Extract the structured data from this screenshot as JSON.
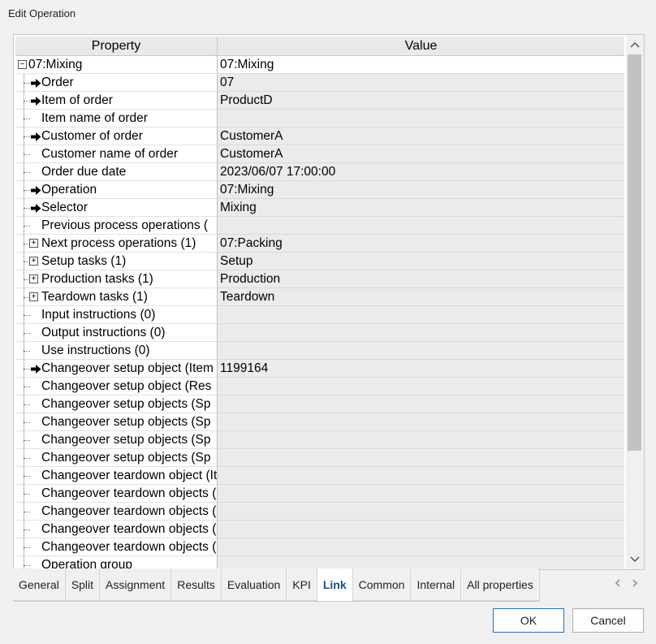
{
  "window": {
    "title": "Edit Operation"
  },
  "grid": {
    "header": {
      "property": "Property",
      "value": "Value"
    },
    "rows": [
      {
        "label": "07:Mixing",
        "value": "07:Mixing",
        "marker": "collapse",
        "root": true
      },
      {
        "label": "Order",
        "value": "07",
        "marker": "arrow"
      },
      {
        "label": "Item of order",
        "value": "ProductD",
        "marker": "arrow"
      },
      {
        "label": "Item name of order",
        "value": "",
        "marker": "none"
      },
      {
        "label": "Customer of order",
        "value": "CustomerA",
        "marker": "arrow"
      },
      {
        "label": "Customer name of order",
        "value": "CustomerA",
        "marker": "none"
      },
      {
        "label": "Order due date",
        "value": "2023/06/07 17:00:00",
        "marker": "none"
      },
      {
        "label": "Operation",
        "value": "07:Mixing",
        "marker": "arrow"
      },
      {
        "label": "Selector",
        "value": "Mixing",
        "marker": "arrow"
      },
      {
        "label": "Previous process operations (",
        "value": "",
        "marker": "none"
      },
      {
        "label": "Next process operations (1)",
        "value": "07:Packing",
        "marker": "expand"
      },
      {
        "label": "Setup tasks (1)",
        "value": "Setup",
        "marker": "expand"
      },
      {
        "label": "Production tasks (1)",
        "value": "Production",
        "marker": "expand"
      },
      {
        "label": "Teardown tasks (1)",
        "value": "Teardown",
        "marker": "expand"
      },
      {
        "label": "Input instructions (0)",
        "value": "",
        "marker": "none"
      },
      {
        "label": "Output instructions (0)",
        "value": "",
        "marker": "none"
      },
      {
        "label": "Use instructions (0)",
        "value": "",
        "marker": "none"
      },
      {
        "label": "Changeover setup object (Item",
        "value": "1199164",
        "marker": "arrow"
      },
      {
        "label": "Changeover setup object (Res",
        "value": "",
        "marker": "none"
      },
      {
        "label": "Changeover setup objects (Sp",
        "value": "",
        "marker": "none"
      },
      {
        "label": "Changeover setup objects (Sp",
        "value": "",
        "marker": "none"
      },
      {
        "label": "Changeover setup objects (Sp",
        "value": "",
        "marker": "none"
      },
      {
        "label": "Changeover setup objects (Sp",
        "value": "",
        "marker": "none"
      },
      {
        "label": "Changeover teardown object (It",
        "value": "",
        "marker": "none"
      },
      {
        "label": "Changeover teardown objects (",
        "value": "",
        "marker": "none"
      },
      {
        "label": "Changeover teardown objects (",
        "value": "",
        "marker": "none"
      },
      {
        "label": "Changeover teardown objects (",
        "value": "",
        "marker": "none"
      },
      {
        "label": "Changeover teardown objects (",
        "value": "",
        "marker": "none"
      },
      {
        "label": "Operation group",
        "value": "",
        "marker": "none"
      }
    ]
  },
  "scrollbar": {
    "up_icon": "chevron-up-icon",
    "down_icon": "chevron-down-icon"
  },
  "tabs": [
    {
      "label": "General",
      "active": false
    },
    {
      "label": "Split",
      "active": false
    },
    {
      "label": "Assignment",
      "active": false
    },
    {
      "label": "Results",
      "active": false
    },
    {
      "label": "Evaluation",
      "active": false
    },
    {
      "label": "KPI",
      "active": false
    },
    {
      "label": "Link",
      "active": true
    },
    {
      "label": "Common",
      "active": false
    },
    {
      "label": "Internal",
      "active": false
    },
    {
      "label": "All properties",
      "active": false
    }
  ],
  "buttons": {
    "ok": "OK",
    "cancel": "Cancel"
  },
  "colors": {
    "active_tab": "#1a4f88",
    "ok_border": "#2a6fb4"
  }
}
